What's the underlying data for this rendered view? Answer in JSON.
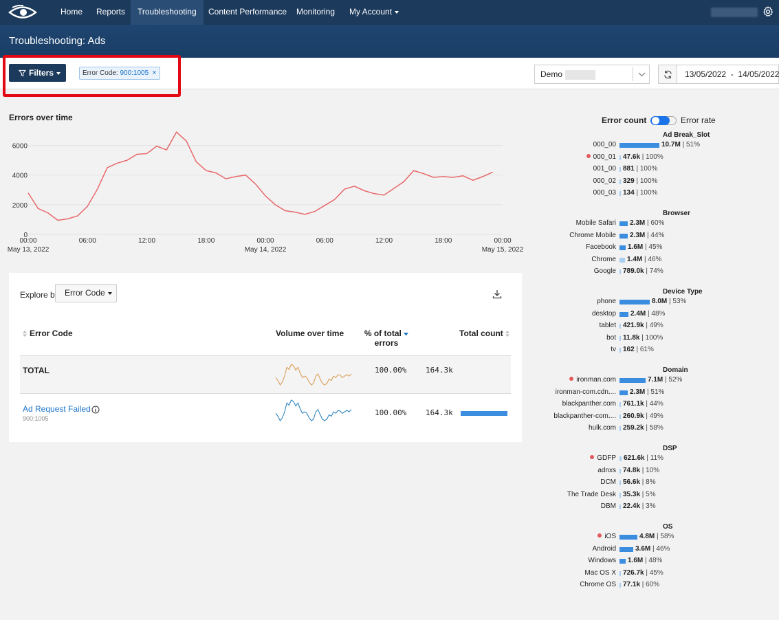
{
  "nav": {
    "items": [
      "Home",
      "Reports",
      "Troubleshooting",
      "Content Performance",
      "Monitoring",
      "My Account"
    ],
    "active": "Troubleshooting"
  },
  "header": {
    "title": "Troubleshooting: Ads"
  },
  "filters": {
    "button_label": "Filters",
    "chip_key": "Error Code: ",
    "chip_value": "900:1005",
    "chip_remove": "×"
  },
  "controls": {
    "account_select": "Demo",
    "date_range": "13/05/2022  -  14/05/2022"
  },
  "errors_chart": {
    "title": "Errors over time",
    "ytick_labels": [
      "6000",
      "4000",
      "2000",
      "0"
    ],
    "xtick_labels": [
      "00:00",
      "06:00",
      "12:00",
      "18:00",
      "00:00",
      "06:00",
      "12:00",
      "18:00",
      "00:00"
    ],
    "date_labels": [
      "May 13, 2022",
      "May 14, 2022",
      "May 15, 2022"
    ]
  },
  "chart_data": {
    "type": "line",
    "title": "Errors over time",
    "xlabel": "",
    "ylabel": "",
    "ylim": [
      0,
      7000
    ],
    "x_unit": "hours since May 13, 2022 00:00",
    "color": "#e8686a",
    "x": [
      0,
      1,
      2,
      3,
      4,
      5,
      6,
      7,
      8,
      9,
      10,
      11,
      12,
      13,
      14,
      15,
      16,
      17,
      18,
      19,
      20,
      21,
      22,
      23,
      24,
      25,
      26,
      27,
      28,
      29,
      30,
      31,
      32,
      33,
      34,
      35,
      36,
      37,
      38,
      39,
      40,
      41,
      42,
      43,
      44,
      45,
      46,
      47
    ],
    "values": [
      2800,
      1750,
      1450,
      950,
      1050,
      1250,
      1900,
      3050,
      4500,
      4800,
      5000,
      5400,
      5450,
      5950,
      5700,
      6900,
      6300,
      4900,
      4300,
      4150,
      3750,
      3900,
      4000,
      3400,
      2600,
      2000,
      1600,
      1500,
      1350,
      1550,
      1950,
      2350,
      3050,
      3250,
      2950,
      2750,
      2650,
      3100,
      3550,
      4300,
      4100,
      3850,
      3900,
      3850,
      3950,
      3650,
      3900,
      4200
    ]
  },
  "explore": {
    "label": "Explore by",
    "select_value": "Error Code",
    "headers": {
      "code": "Error Code",
      "volume": "Volume over time",
      "pct": "% of total",
      "pct2": "errors",
      "count": "Total count"
    },
    "total": {
      "label": "TOTAL",
      "pct": "100.00%",
      "count": "164.3k",
      "spark_color": "#d9a05b"
    },
    "rows": [
      {
        "name": "Ad Request Failed",
        "code": "900:1005",
        "pct": "100.00%",
        "count": "164.3k",
        "spark_color": "#2f86c2",
        "bar_fraction": 1.0
      }
    ],
    "sparkline": [
      20,
      16,
      10,
      14,
      22,
      34,
      31,
      38,
      36,
      30,
      34,
      26,
      20,
      22,
      20,
      14,
      10,
      12,
      22,
      25,
      18,
      12,
      10,
      12,
      18,
      16,
      22,
      20,
      24,
      23,
      20,
      22,
      24,
      22,
      25
    ]
  },
  "breakdown": {
    "toggle_left": "Error count",
    "toggle_right": "Error rate",
    "bar_color": "#3b8de0",
    "bar_color_light": "#a8cff2",
    "groups": [
      {
        "title": "Ad Break_Slot",
        "rows": [
          {
            "label": "000_00",
            "value": "10.7M",
            "pct": "51%",
            "fraction": 1.0,
            "dot": false
          },
          {
            "label": "000_01",
            "value": "47.6k",
            "pct": "100%",
            "fraction": 0.01,
            "dot": true
          },
          {
            "label": "001_00",
            "value": "881",
            "pct": "100%",
            "fraction": 0.0,
            "dot": false
          },
          {
            "label": "000_02",
            "value": "329",
            "pct": "100%",
            "fraction": 0.0,
            "dot": false
          },
          {
            "label": "000_03",
            "value": "134",
            "pct": "100%",
            "fraction": 0.0,
            "dot": false
          }
        ]
      },
      {
        "title": "Browser",
        "rows": [
          {
            "label": "Mobile Safari",
            "value": "2.3M",
            "pct": "60%",
            "fraction": 0.21,
            "dot": false
          },
          {
            "label": "Chrome Mobile",
            "value": "2.3M",
            "pct": "44%",
            "fraction": 0.21,
            "dot": false
          },
          {
            "label": "Facebook",
            "value": "1.6M",
            "pct": "45%",
            "fraction": 0.15,
            "dot": false
          },
          {
            "label": "Chrome",
            "value": "1.4M",
            "pct": "46%",
            "fraction": 0.13,
            "dot": false
          },
          {
            "label": "Google",
            "value": "789.0k",
            "pct": "74%",
            "fraction": 0.0,
            "dot": false
          }
        ]
      },
      {
        "title": "Device Type",
        "rows": [
          {
            "label": "phone",
            "value": "8.0M",
            "pct": "53%",
            "fraction": 0.75,
            "dot": false
          },
          {
            "label": "desktop",
            "value": "2.4M",
            "pct": "48%",
            "fraction": 0.22,
            "dot": false
          },
          {
            "label": "tablet",
            "value": "421.9k",
            "pct": "49%",
            "fraction": 0.01,
            "dot": false
          },
          {
            "label": "bot",
            "value": "11.8k",
            "pct": "100%",
            "fraction": 0.0,
            "dot": false
          },
          {
            "label": "tv",
            "value": "162",
            "pct": "61%",
            "fraction": 0.0,
            "dot": false
          }
        ]
      },
      {
        "title": "Domain",
        "rows": [
          {
            "label": "ironman.com",
            "value": "7.1M",
            "pct": "52%",
            "fraction": 0.66,
            "dot": true
          },
          {
            "label": "ironman-com.cdn....",
            "value": "2.3M",
            "pct": "51%",
            "fraction": 0.21,
            "dot": false
          },
          {
            "label": "blackpanther.com",
            "value": "761.1k",
            "pct": "44%",
            "fraction": 0.01,
            "dot": false
          },
          {
            "label": "blackpanther-com....",
            "value": "260.9k",
            "pct": "49%",
            "fraction": 0.0,
            "dot": false
          },
          {
            "label": "hulk.com",
            "value": "259.2k",
            "pct": "58%",
            "fraction": 0.0,
            "dot": false
          }
        ]
      },
      {
        "title": "DSP",
        "rows": [
          {
            "label": "GDFP",
            "value": "621.6k",
            "pct": "11%",
            "fraction": 0.05,
            "dot": true
          },
          {
            "label": "adnxs",
            "value": "74.8k",
            "pct": "10%",
            "fraction": 0.0,
            "dot": false
          },
          {
            "label": "DCM",
            "value": "56.6k",
            "pct": "8%",
            "fraction": 0.0,
            "dot": false
          },
          {
            "label": "The Trade Desk",
            "value": "35.3k",
            "pct": "5%",
            "fraction": 0.0,
            "dot": false
          },
          {
            "label": "DBM",
            "value": "22.4k",
            "pct": "3%",
            "fraction": 0.0,
            "dot": false
          }
        ]
      },
      {
        "title": "OS",
        "rows": [
          {
            "label": "iOS",
            "value": "4.8M",
            "pct": "58%",
            "fraction": 0.45,
            "dot": true
          },
          {
            "label": "Android",
            "value": "3.6M",
            "pct": "46%",
            "fraction": 0.34,
            "dot": false
          },
          {
            "label": "Windows",
            "value": "1.6M",
            "pct": "48%",
            "fraction": 0.15,
            "dot": false
          },
          {
            "label": "Mac OS X",
            "value": "726.7k",
            "pct": "45%",
            "fraction": 0.0,
            "dot": false
          },
          {
            "label": "Chrome OS",
            "value": "77.1k",
            "pct": "60%",
            "fraction": 0.0,
            "dot": false
          }
        ]
      }
    ]
  }
}
